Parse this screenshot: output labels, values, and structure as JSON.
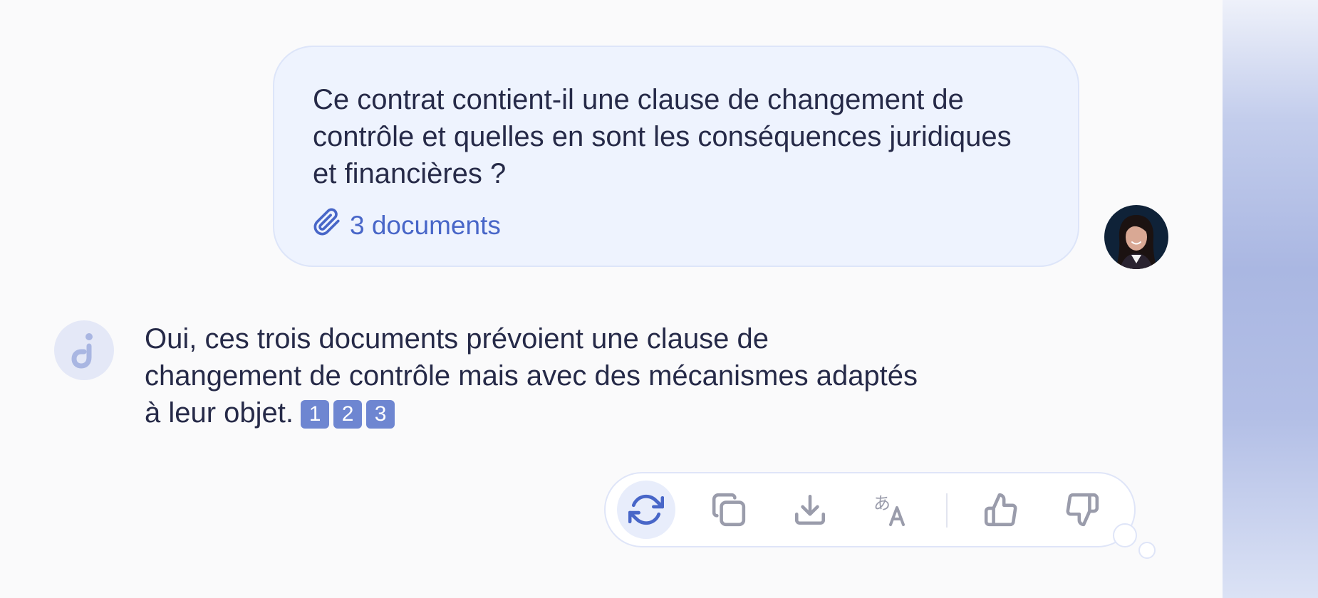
{
  "user_message": {
    "text": "Ce contrat contient-il une clause de changement de contrôle et quelles en sont les conséquences juridiques et financières ?",
    "attachments_label": "3 documents",
    "attachment_icon": "paperclip-icon"
  },
  "assistant_message": {
    "text": "Oui, ces trois documents prévoient une clause de changement de contrôle mais avec des mécanismes adaptés à leur objet.",
    "citations": [
      "1",
      "2",
      "3"
    ]
  },
  "toolbar": {
    "actions": [
      {
        "name": "regenerate",
        "icon": "refresh-icon",
        "active": true
      },
      {
        "name": "copy",
        "icon": "copy-icon"
      },
      {
        "name": "download",
        "icon": "download-icon"
      },
      {
        "name": "translate",
        "icon": "translate-icon"
      },
      {
        "name": "like",
        "icon": "thumbs-up-icon"
      },
      {
        "name": "dislike",
        "icon": "thumbs-down-icon"
      }
    ]
  },
  "colors": {
    "accent": "#4866c8",
    "citation_badge": "#6e86d1",
    "user_bubble": "#eef3fe",
    "text": "#262a48",
    "icon_gray": "#9a9cab"
  }
}
